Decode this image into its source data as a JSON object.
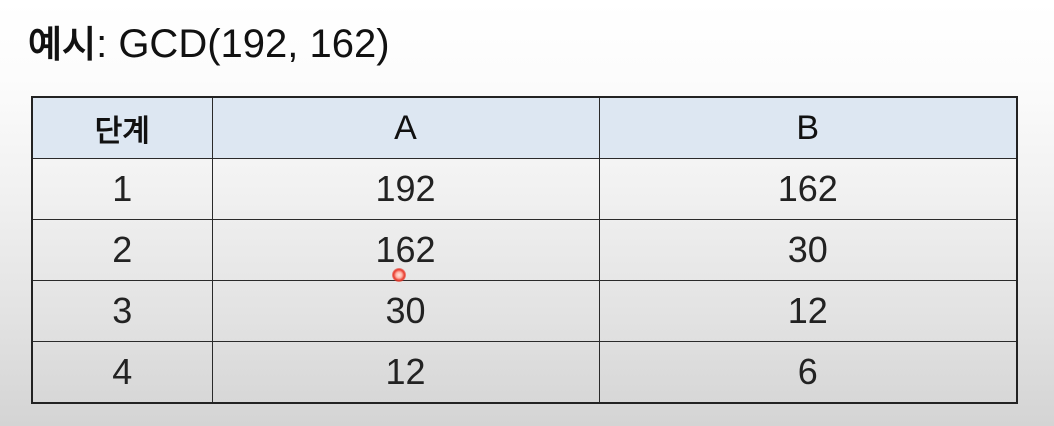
{
  "title": {
    "bold": "예시",
    "rest": ": GCD(192, 162)"
  },
  "table": {
    "headers": [
      "단계",
      "A",
      "B"
    ],
    "rows": [
      [
        "1",
        "192",
        "162"
      ],
      [
        "2",
        "162",
        "30"
      ],
      [
        "3",
        "30",
        "12"
      ],
      [
        "4",
        "12",
        "6"
      ]
    ]
  },
  "colors": {
    "header_bg": "#dde7f2",
    "border": "#222222",
    "cursor": "#e8382a"
  }
}
